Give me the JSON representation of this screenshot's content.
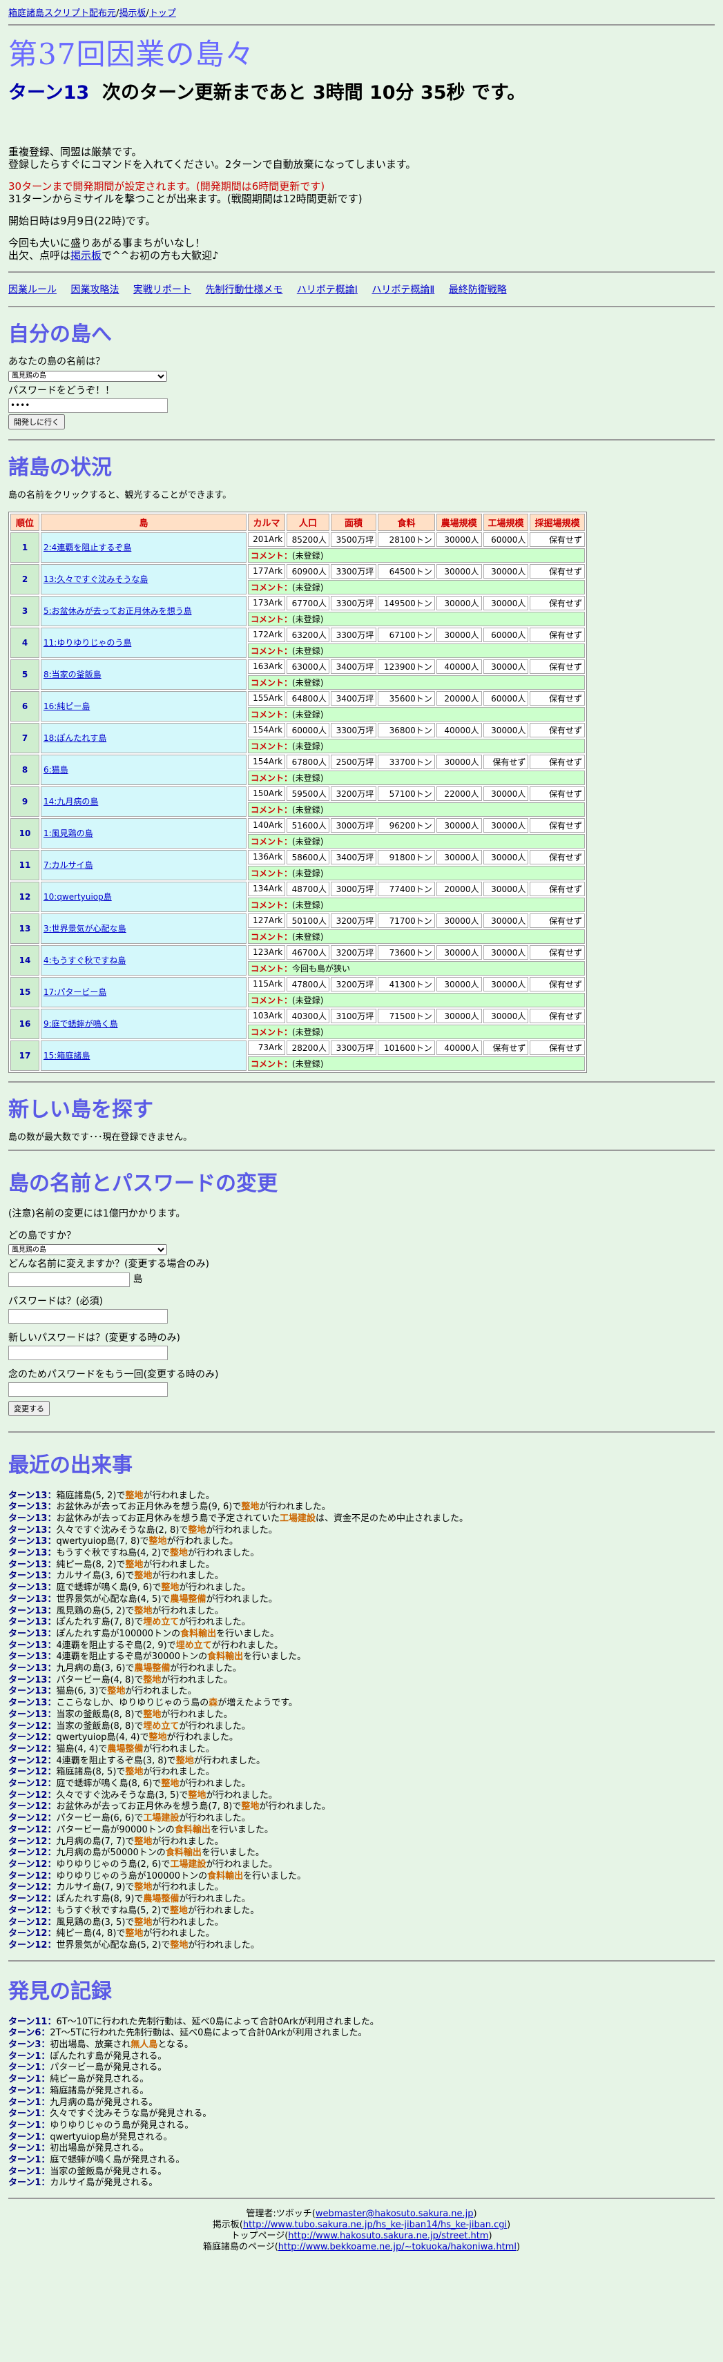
{
  "toplinks": [
    "箱庭諸島スクリプト配布元",
    "揭示板",
    "トップ"
  ],
  "title": "第37回因業の島々",
  "turn": {
    "label": "ターン13",
    "text": "次のターン更新まであと 3時間 10分 35秒 です。"
  },
  "notices": {
    "line1": "重複登録、同盟は厳禁です。",
    "line2": "登録したらすぐにコマンドを入れてください。2ターンで自動放棄になってしまいます。",
    "red": "30ターンまで開発期間が設定されます。(開発期間は6時間更新です)",
    "line3": "31ターンからミサイルを撃つことが出来ます。(戦闘期間は12時間更新です)",
    "line4": "開始日時は9月9日(22時)です。",
    "line5": "今回も大いに盛りあがる事まちがいなし！",
    "line6a": "出欠、点呼は",
    "line6link": "掲示板",
    "line6b": "で^^お初の方も大歓迎♪"
  },
  "navlinks": [
    "因業ルール",
    "因業攻略法",
    "実戦リポート",
    "先制行動仕様メモ",
    "ハリボテ概論Ⅰ",
    "ハリボテ概論Ⅱ",
    "最終防衛戦略"
  ],
  "my_island": {
    "heading": "自分の島へ",
    "q_name": "あなたの島の名前は？",
    "select_value": "風見鶏の島",
    "q_pass": "パスワードをどうぞ！！",
    "pass_value": "••••",
    "button": "開発しに行く"
  },
  "status": {
    "heading": "諸島の状況",
    "desc": "島の名前をクリックすると、観光することができます。",
    "headers": [
      "順位",
      "島",
      "カルマ",
      "人口",
      "面積",
      "食料",
      "農場規模",
      "工場規模",
      "採掘場規模"
    ],
    "comment_label": "コメント：",
    "rows": [
      {
        "rank": "1",
        "name": "2:4連覇を阻止するぞ島",
        "karma": "201Ark",
        "pop": "85200人",
        "area": "3500万坪",
        "food": "28100トン",
        "farm": "30000人",
        "factory": "60000人",
        "mine": "保有せず",
        "comment": "(未登録)"
      },
      {
        "rank": "2",
        "name": "13:久々ですぐ沈みそうな島",
        "karma": "177Ark",
        "pop": "60900人",
        "area": "3300万坪",
        "food": "64500トン",
        "farm": "30000人",
        "factory": "30000人",
        "mine": "保有せず",
        "comment": "(未登録)"
      },
      {
        "rank": "3",
        "name": "5:お盆休みが去ってお正月休みを想う島",
        "karma": "173Ark",
        "pop": "67700人",
        "area": "3300万坪",
        "food": "149500トン",
        "farm": "30000人",
        "factory": "30000人",
        "mine": "保有せず",
        "comment": "(未登録)"
      },
      {
        "rank": "4",
        "name": "11:ゆりゆりじゃのう島",
        "karma": "172Ark",
        "pop": "63200人",
        "area": "3300万坪",
        "food": "67100トン",
        "farm": "30000人",
        "factory": "60000人",
        "mine": "保有せず",
        "comment": "(未登録)"
      },
      {
        "rank": "5",
        "name": "8:当家の釜飯島",
        "karma": "163Ark",
        "pop": "63000人",
        "area": "3400万坪",
        "food": "123900トン",
        "farm": "40000人",
        "factory": "30000人",
        "mine": "保有せず",
        "comment": "(未登録)"
      },
      {
        "rank": "6",
        "name": "16:純ピー島",
        "karma": "155Ark",
        "pop": "64800人",
        "area": "3400万坪",
        "food": "35600トン",
        "farm": "20000人",
        "factory": "60000人",
        "mine": "保有せず",
        "comment": "(未登録)"
      },
      {
        "rank": "7",
        "name": "18:ぽんたれす島",
        "karma": "154Ark",
        "pop": "60000人",
        "area": "3300万坪",
        "food": "36800トン",
        "farm": "40000人",
        "factory": "30000人",
        "mine": "保有せず",
        "comment": "(未登録)"
      },
      {
        "rank": "8",
        "name": "6:猫島",
        "karma": "154Ark",
        "pop": "67800人",
        "area": "2500万坪",
        "food": "33700トン",
        "farm": "30000人",
        "factory": "保有せず",
        "mine": "保有せず",
        "comment": "(未登録)"
      },
      {
        "rank": "9",
        "name": "14:九月病の島",
        "karma": "150Ark",
        "pop": "59500人",
        "area": "3200万坪",
        "food": "57100トン",
        "farm": "22000人",
        "factory": "30000人",
        "mine": "保有せず",
        "comment": "(未登録)"
      },
      {
        "rank": "10",
        "name": "1:風見鶏の島",
        "karma": "140Ark",
        "pop": "51600人",
        "area": "3000万坪",
        "food": "96200トン",
        "farm": "30000人",
        "factory": "30000人",
        "mine": "保有せず",
        "comment": "(未登録)"
      },
      {
        "rank": "11",
        "name": "7:カルサイ島",
        "karma": "136Ark",
        "pop": "58600人",
        "area": "3400万坪",
        "food": "91800トン",
        "farm": "30000人",
        "factory": "30000人",
        "mine": "保有せず",
        "comment": "(未登録)"
      },
      {
        "rank": "12",
        "name": "10:qwertyuiop島",
        "karma": "134Ark",
        "pop": "48700人",
        "area": "3000万坪",
        "food": "77400トン",
        "farm": "20000人",
        "factory": "30000人",
        "mine": "保有せず",
        "comment": "(未登録)"
      },
      {
        "rank": "13",
        "name": "3:世界景気が心配な島",
        "karma": "127Ark",
        "pop": "50100人",
        "area": "3200万坪",
        "food": "71700トン",
        "farm": "30000人",
        "factory": "30000人",
        "mine": "保有せず",
        "comment": "(未登録)"
      },
      {
        "rank": "14",
        "name": "4:もうすぐ秋ですね島",
        "karma": "123Ark",
        "pop": "46700人",
        "area": "3200万坪",
        "food": "73600トン",
        "farm": "30000人",
        "factory": "30000人",
        "mine": "保有せず",
        "comment": "今回も島が狭い"
      },
      {
        "rank": "15",
        "name": "17:パタービー島",
        "karma": "115Ark",
        "pop": "47800人",
        "area": "3200万坪",
        "food": "41300トン",
        "farm": "30000人",
        "factory": "30000人",
        "mine": "保有せず",
        "comment": "(未登録)"
      },
      {
        "rank": "16",
        "name": "9:庭で蟋蟀が鳴く島",
        "karma": "103Ark",
        "pop": "40300人",
        "area": "3100万坪",
        "food": "71500トン",
        "farm": "30000人",
        "factory": "30000人",
        "mine": "保有せず",
        "comment": "(未登録)"
      },
      {
        "rank": "17",
        "name": "15:箱庭諸島",
        "karma": "73Ark",
        "pop": "28200人",
        "area": "3300万坪",
        "food": "101600トン",
        "farm": "40000人",
        "factory": "保有せず",
        "mine": "保有せず",
        "comment": "(未登録)"
      }
    ]
  },
  "new_island": {
    "heading": "新しい島を探す",
    "text": "島の数が最大数です･･･現在登録できません。"
  },
  "rename": {
    "heading": "島の名前とパスワードの変更",
    "note": "(注意)名前の変更には1億円かかります。",
    "q_which": "どの島ですか？",
    "select_value": "風見鶏の島",
    "q_newname": "どんな名前に変えますか？(変更する場合のみ)",
    "suffix": "島",
    "q_pass": "パスワードは？(必須)",
    "q_newpass": "新しいパスワードは？(変更する時のみ)",
    "q_confirm": "念のためパスワードをもう一回(変更する時のみ)",
    "button": "変更する"
  },
  "events": {
    "heading": "最近の出来事",
    "items": [
      {
        "t": "ターン13：",
        "s": "箱庭諸島(5, 2)で",
        "h": "整地",
        "e": "が行われました。"
      },
      {
        "t": "ターン13：",
        "s": "お盆休みが去ってお正月休みを想う島(9, 6)で",
        "h": "整地",
        "e": "が行われました。"
      },
      {
        "t": "ターン13：",
        "s": "お盆休みが去ってお正月休みを想う島で予定されていた",
        "h": "工場建設",
        "e": "は、資金不足のため中止されました。"
      },
      {
        "t": "ターン13：",
        "s": "久々ですぐ沈みそうな島(2, 8)で",
        "h": "整地",
        "e": "が行われました。"
      },
      {
        "t": "ターン13：",
        "s": "qwertyuiop島(7, 8)で",
        "h": "整地",
        "e": "が行われました。"
      },
      {
        "t": "ターン13：",
        "s": "もうすぐ秋ですね島(4, 2)で",
        "h": "整地",
        "e": "が行われました。"
      },
      {
        "t": "ターン13：",
        "s": "純ピー島(8, 2)で",
        "h": "整地",
        "e": "が行われました。"
      },
      {
        "t": "ターン13：",
        "s": "カルサイ島(3, 6)で",
        "h": "整地",
        "e": "が行われました。"
      },
      {
        "t": "ターン13：",
        "s": "庭で蟋蟀が鳴く島(9, 6)で",
        "h": "整地",
        "e": "が行われました。"
      },
      {
        "t": "ターン13：",
        "s": "世界景気が心配な島(4, 5)で",
        "h": "農場整備",
        "e": "が行われました。"
      },
      {
        "t": "ターン13：",
        "s": "風見鶏の島(5, 2)で",
        "h": "整地",
        "e": "が行われました。"
      },
      {
        "t": "ターン13：",
        "s": "ぽんたれす島(7, 8)で",
        "h": "埋め立て",
        "e": "が行われました。"
      },
      {
        "t": "ターン13：",
        "s": "ぽんたれす島が100000トンの",
        "h": "食料輸出",
        "e": "を行いました。"
      },
      {
        "t": "ターン13：",
        "s": "4連覇を阻止するぞ島(2, 9)で",
        "h": "埋め立て",
        "e": "が行われました。"
      },
      {
        "t": "ターン13：",
        "s": "4連覇を阻止するぞ島が30000トンの",
        "h": "食料輸出",
        "e": "を行いました。"
      },
      {
        "t": "ターン13：",
        "s": "九月病の島(3, 6)で",
        "h": "農場整備",
        "e": "が行われました。"
      },
      {
        "t": "ターン13：",
        "s": "パタービー島(4, 8)で",
        "h": "整地",
        "e": "が行われました。"
      },
      {
        "t": "ターン13：",
        "s": "猫島(6, 3)で",
        "h": "整地",
        "e": "が行われました。"
      },
      {
        "t": "ターン13：",
        "s": "ここらなしか、ゆりゆりじゃのう島の",
        "h": "森",
        "e": "が増えたようです。"
      },
      {
        "t": "ターン13：",
        "s": "当家の釜飯島(8, 8)で",
        "h": "整地",
        "e": "が行われました。"
      },
      {
        "t": "ターン12：",
        "s": "当家の釜飯島(8, 8)で",
        "h": "埋め立て",
        "e": "が行われました。"
      },
      {
        "t": "ターン12：",
        "s": "qwertyuiop島(4, 4)で",
        "h": "整地",
        "e": "が行われました。"
      },
      {
        "t": "ターン12：",
        "s": "猫島(4, 4)で",
        "h": "農場整備",
        "e": "が行われました。"
      },
      {
        "t": "ターン12：",
        "s": "4連覇を阻止するぞ島(3, 8)で",
        "h": "整地",
        "e": "が行われました。"
      },
      {
        "t": "ターン12：",
        "s": "箱庭諸島(8, 5)で",
        "h": "整地",
        "e": "が行われました。"
      },
      {
        "t": "ターン12：",
        "s": "庭で蟋蟀が鳴く島(8, 6)で",
        "h": "整地",
        "e": "が行われました。"
      },
      {
        "t": "ターン12：",
        "s": "久々ですぐ沈みそうな島(3, 5)で",
        "h": "整地",
        "e": "が行われました。"
      },
      {
        "t": "ターン12：",
        "s": "お盆休みが去ってお正月休みを想う島(7, 8)で",
        "h": "整地",
        "e": "が行われました。"
      },
      {
        "t": "ターン12：",
        "s": "パタービー島(6, 6)で",
        "h": "工場建設",
        "e": "が行われました。"
      },
      {
        "t": "ターン12：",
        "s": "パタービー島が90000トンの",
        "h": "食料輸出",
        "e": "を行いました。"
      },
      {
        "t": "ターン12：",
        "s": "九月病の島(7, 7)で",
        "h": "整地",
        "e": "が行われました。"
      },
      {
        "t": "ターン12：",
        "s": "九月病の島が50000トンの",
        "h": "食料輸出",
        "e": "を行いました。"
      },
      {
        "t": "ターン12：",
        "s": "ゆりゆりじゃのう島(2, 6)で",
        "h": "工場建設",
        "e": "が行われました。"
      },
      {
        "t": "ターン12：",
        "s": "ゆりゆりじゃのう島が100000トンの",
        "h": "食料輸出",
        "e": "を行いました。"
      },
      {
        "t": "ターン12：",
        "s": "カルサイ島(7, 9)で",
        "h": "整地",
        "e": "が行われました。"
      },
      {
        "t": "ターン12：",
        "s": "ぽんたれす島(8, 9)で",
        "h": "農場整備",
        "e": "が行われました。"
      },
      {
        "t": "ターン12：",
        "s": "もうすぐ秋ですね島(5, 2)で",
        "h": "整地",
        "e": "が行われました。"
      },
      {
        "t": "ターン12：",
        "s": "風見鶏の島(3, 5)で",
        "h": "整地",
        "e": "が行われました。"
      },
      {
        "t": "ターン12：",
        "s": "純ピー島(4, 8)で",
        "h": "整地",
        "e": "が行われました。"
      },
      {
        "t": "ターン12：",
        "s": "世界景気が心配な島(5, 2)で",
        "h": "整地",
        "e": "が行われました。"
      }
    ]
  },
  "discoveries": {
    "heading": "発見の記録",
    "items": [
      {
        "t": "ターン11：",
        "s": "6T〜10Tに行われた先制行動は、延べ0島によって合計0Arkが利用されました。",
        "h": "",
        "e": ""
      },
      {
        "t": "ターン6：",
        "s": "2T〜5Tに行われた先制行動は、延べ0島によって合計0Arkが利用されました。",
        "h": "",
        "e": ""
      },
      {
        "t": "ターン3：",
        "s": "初出場島、放棄され",
        "h": "無人島",
        "e": "となる。"
      },
      {
        "t": "ターン1：",
        "s": "ぽんたれす島が発見される。",
        "h": "",
        "e": ""
      },
      {
        "t": "ターン1：",
        "s": "パタービー島が発見される。",
        "h": "",
        "e": ""
      },
      {
        "t": "ターン1：",
        "s": "純ピー島が発見される。",
        "h": "",
        "e": ""
      },
      {
        "t": "ターン1：",
        "s": "箱庭諸島が発見される。",
        "h": "",
        "e": ""
      },
      {
        "t": "ターン1：",
        "s": "九月病の島が発見される。",
        "h": "",
        "e": ""
      },
      {
        "t": "ターン1：",
        "s": "久々ですぐ沈みそうな島が発見される。",
        "h": "",
        "e": ""
      },
      {
        "t": "ターン1：",
        "s": "ゆりゆりじゃのう島が発見される。",
        "h": "",
        "e": ""
      },
      {
        "t": "ターン1：",
        "s": "qwertyuiop島が発見される。",
        "h": "",
        "e": ""
      },
      {
        "t": "ターン1：",
        "s": "初出場島が発見される。",
        "h": "",
        "e": ""
      },
      {
        "t": "ターン1：",
        "s": "庭で蟋蟀が鳴く島が発見される。",
        "h": "",
        "e": ""
      },
      {
        "t": "ターン1：",
        "s": "当家の釜飯島が発見される。",
        "h": "",
        "e": ""
      },
      {
        "t": "ターン1：",
        "s": "カルサイ島が発見される。",
        "h": "",
        "e": ""
      }
    ]
  },
  "footer": {
    "admin_label": "管理者:ツボッチ(",
    "admin_mail": "webmaster@hakosuto.sakura.ne.jp",
    "bbs_label": "掲示板(",
    "bbs_url": "http://www.tubo.sakura.ne.jp/hs_ke-jiban14/hs_ke-jiban.cgi",
    "top_label": "トップページ(",
    "top_url": "http://www.hakosuto.sakura.ne.jp/street.htm",
    "hako_label": "箱庭諸島のページ(",
    "hako_url": "http://www.bekkoame.ne.jp/~tokuoka/hakoniwa.html",
    "close": ")"
  }
}
